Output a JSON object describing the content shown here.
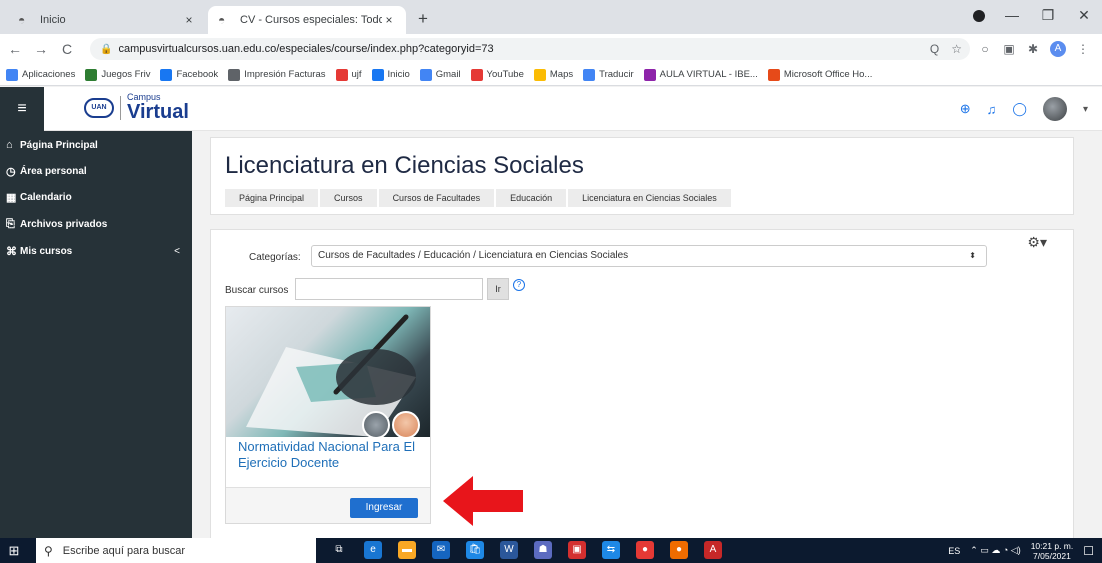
{
  "browser": {
    "tabs": [
      {
        "title": "Inicio",
        "close": "×"
      },
      {
        "title": "CV - Cursos especiales: Todos los",
        "close": "×"
      }
    ],
    "new_tab": "+",
    "window_buttons": {
      "minimize": "—",
      "maximize": "❐",
      "close": "✕"
    },
    "nav": {
      "back": "←",
      "forward": "→",
      "reload": "C"
    },
    "url": "campusvirtualcursos.uan.edu.co/especiales/course/index.php?categoryid=73",
    "omnibox_icons": {
      "zoom": "Q",
      "star": "☆"
    },
    "extensions": {
      "ext1": "○",
      "ext2": "▣",
      "puzzle": "✱",
      "profile": "A",
      "menu": "⋮"
    },
    "bookmarks": [
      {
        "label": "Aplicaciones",
        "icon": "apps-icon",
        "color": "#4285f4"
      },
      {
        "label": "Juegos Friv",
        "icon": "friv-icon",
        "color": "#2e7d32"
      },
      {
        "label": "Facebook",
        "icon": "facebook-icon",
        "color": "#1877f2"
      },
      {
        "label": "Impresión Facturas",
        "icon": "globe-icon",
        "color": "#5f6368"
      },
      {
        "label": "ujf",
        "icon": "youtube-icon",
        "color": "#e53935"
      },
      {
        "label": "Inicio",
        "icon": "facebook-icon",
        "color": "#1877f2"
      },
      {
        "label": "Gmail",
        "icon": "google-icon",
        "color": "#4285f4"
      },
      {
        "label": "YouTube",
        "icon": "youtube-icon",
        "color": "#e53935"
      },
      {
        "label": "Maps",
        "icon": "maps-icon",
        "color": "#fbbc04"
      },
      {
        "label": "Traducir",
        "icon": "translate-icon",
        "color": "#4285f4"
      },
      {
        "label": "AULA VIRTUAL - IBE...",
        "icon": "aula-icon",
        "color": "#8e24aa"
      },
      {
        "label": "Microsoft Office Ho...",
        "icon": "office-icon",
        "color": "#e64a19"
      }
    ]
  },
  "header": {
    "menu_icon": "≡",
    "logo_seal": "UAN",
    "logo_small": "Campus",
    "logo_big": "Virtual",
    "icons": {
      "language": "⊕",
      "notifications": "♫",
      "messages": "◯",
      "user_menu": "▾"
    }
  },
  "sidebar": {
    "items": [
      {
        "icon": "⌂",
        "label": "Página Principal"
      },
      {
        "icon": "◷",
        "label": "Área personal"
      },
      {
        "icon": "▦",
        "label": "Calendario"
      },
      {
        "icon": "⎘",
        "label": "Archivos privados"
      },
      {
        "icon": "⌘",
        "label": "Mis cursos",
        "chevron": "<"
      }
    ]
  },
  "page": {
    "title": "Licenciatura en Ciencias Sociales",
    "breadcrumb": [
      "Página Principal",
      "Cursos",
      "Cursos de Facultades",
      "Educación",
      "Licenciatura en Ciencias Sociales"
    ],
    "settings_icon": "⚙▾",
    "categories_label": "Categorías:",
    "categories_value": "Cursos de Facultades / Educación / Licenciatura en Ciencias Sociales",
    "select_arrow": "⬍",
    "search_label": "Buscar cursos",
    "search_placeholder": "",
    "search_button": "Ir",
    "help": "?",
    "course": {
      "name": "Normatividad Nacional Para El Ejercicio Docente",
      "button": "Ingresar"
    }
  },
  "taskbar": {
    "start": "⊞",
    "search_icon": "⚲",
    "search_placeholder": "Escribe aquí para buscar",
    "apps": [
      {
        "glyph": "⧉",
        "color": "#0c1a2f"
      },
      {
        "glyph": "e",
        "color": "#1976d2"
      },
      {
        "glyph": "▬",
        "color": "#f9a825"
      },
      {
        "glyph": "✉",
        "color": "#1565c0"
      },
      {
        "glyph": "🛍",
        "color": "#1e88e5"
      },
      {
        "glyph": "W",
        "color": "#2b579a"
      },
      {
        "glyph": "☗",
        "color": "#5c6bc0"
      },
      {
        "glyph": "▣",
        "color": "#d32f2f"
      },
      {
        "glyph": "⇆",
        "color": "#1e88e5"
      },
      {
        "glyph": "●",
        "color": "#e53935"
      },
      {
        "glyph": "●",
        "color": "#ef6c00"
      },
      {
        "glyph": "A",
        "color": "#c62828"
      }
    ],
    "lang": "ES",
    "tray_icons": "⌃ ▭ ☁ ◔ ◁)",
    "time": "10:21 p. m.",
    "date": "7/05/2021",
    "notification": "☐"
  }
}
